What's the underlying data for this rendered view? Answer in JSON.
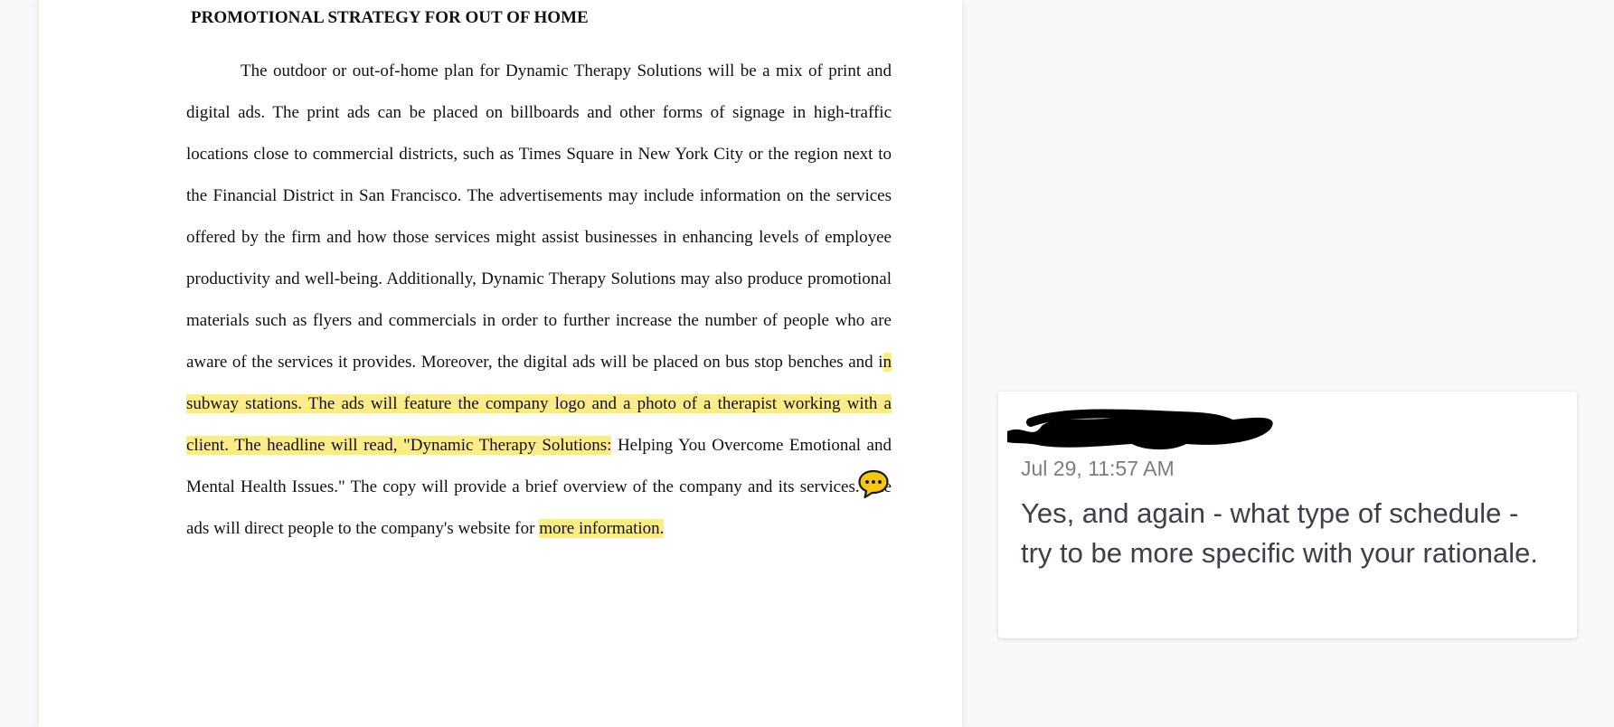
{
  "document": {
    "heading": "PROMOTIONAL STRATEGY FOR OUT OF HOME",
    "body": {
      "before_highlight": "The outdoor or out-of-home plan for Dynamic Therapy Solutions will be a mix of print and digital ads. The print ads can be placed on billboards and other forms of signage in high-traffic locations close to commercial districts, such as Times Square in New York City or the region next to the Financial District in San Francisco. The advertisements may include information on the services offered by the firm and how those services might assist businesses in enhancing levels of employee productivity and well-being. Additionally, Dynamic Therapy Solutions may also produce promotional materials such as flyers and commercials in order to further increase the number of people who are aware of the services it provides. Moreover, the digital ads will be placed on bus stop benches and i",
      "highlight_1": "n subway stations. The ads will feature the company logo and a photo of a therapist working with a client. The headline will read, \"Dynamic Therapy Solutions:",
      "middle": " Helping You Overcome Emotional and Mental Health Issues.\" The copy will provide a brief overview of the company and its services. The ads will direct people to the company's website for ",
      "highlight_2": "more information."
    },
    "highlight_color": "#fbeb8b"
  },
  "comment_marker": {
    "icon": "speech-bubble-icon",
    "color": "#f5c518"
  },
  "comment": {
    "author_redacted": true,
    "timestamp": "Jul 29, 11:57 AM",
    "text": "Yes, and again - what type of schedule - try to be more specific with your rationale."
  }
}
